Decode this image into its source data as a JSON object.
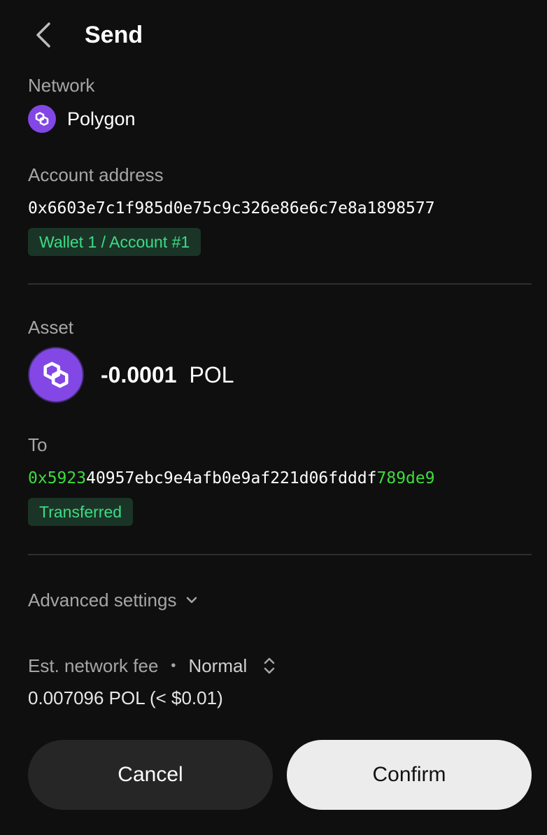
{
  "header": {
    "title": "Send",
    "back_icon": "chevron-left-icon"
  },
  "network": {
    "label": "Network",
    "name": "Polygon",
    "icon": "polygon-logo-icon",
    "icon_color": "#8247e5"
  },
  "account": {
    "label": "Account address",
    "address": "0x6603e7c1f985d0e75c9c326e86e6c7e8a1898577",
    "wallet_badge": "Wallet 1 / Account #1"
  },
  "asset": {
    "label": "Asset",
    "amount": "-0.0001",
    "symbol": "POL",
    "icon": "polygon-logo-icon"
  },
  "recipient": {
    "label": "To",
    "address_prefix": "0x5923",
    "address_middle": "40957ebc9e4afb0e9af221d06fdddf",
    "address_suffix": "789de9",
    "status_badge": "Transferred"
  },
  "advanced": {
    "label": "Advanced settings",
    "icon": "chevron-down-icon"
  },
  "fee": {
    "label": "Est. network fee",
    "separator": "•",
    "speed": "Normal",
    "speed_icon": "up-down-chevron-icon",
    "value": "0.007096 POL (< $0.01)"
  },
  "actions": {
    "cancel_label": "Cancel",
    "confirm_label": "Confirm"
  },
  "colors": {
    "background": "#0f0f0f",
    "accent_green": "#3ddc84",
    "address_highlight": "#3ddc3d",
    "polygon_purple": "#8247e5"
  }
}
